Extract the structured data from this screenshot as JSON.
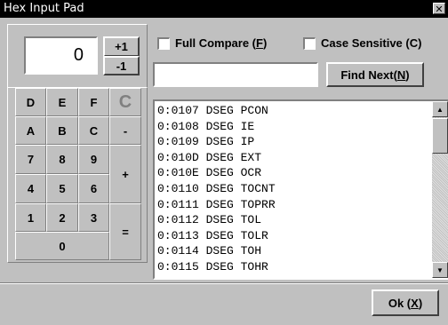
{
  "window": {
    "title": "Hex Input Pad",
    "close_glyph": "✕"
  },
  "display": {
    "value": "0"
  },
  "buttons": {
    "plus_one": "+1",
    "minus_one": "-1",
    "find_next_prefix": "Find Next(",
    "find_next_hotkey": "N",
    "find_next_suffix": ")",
    "ok_prefix": "Ok (",
    "ok_hotkey": "X",
    "ok_suffix": ")"
  },
  "keypad": {
    "d": "D",
    "e": "E",
    "f": "F",
    "clear": "C",
    "a": "A",
    "b": "B",
    "c": "C",
    "minus": "-",
    "k7": "7",
    "k8": "8",
    "k9": "9",
    "plus": "+",
    "k4": "4",
    "k5": "5",
    "k6": "6",
    "k1": "1",
    "k2": "2",
    "k3": "3",
    "equals": "=",
    "k0": "0"
  },
  "options": {
    "full_compare_prefix": "Full Compare (",
    "full_compare_hotkey": "F",
    "full_compare_suffix": ")",
    "case_sensitive_prefix": "Case Sensitive (",
    "case_sensitive_hotkey": "C",
    "case_sensitive_suffix": ")"
  },
  "search": {
    "value": ""
  },
  "symbols": [
    "0:0107 DSEG PCON",
    "0:0108 DSEG IE",
    "0:0109 DSEG IP",
    "0:010D DSEG EXT",
    "0:010E DSEG OCR",
    "0:0110 DSEG TOCNT",
    "0:0111 DSEG TOPRR",
    "0:0112 DSEG TOL",
    "0:0113 DSEG TOLR",
    "0:0114 DSEG TOH",
    "0:0115 DSEG TOHR"
  ]
}
